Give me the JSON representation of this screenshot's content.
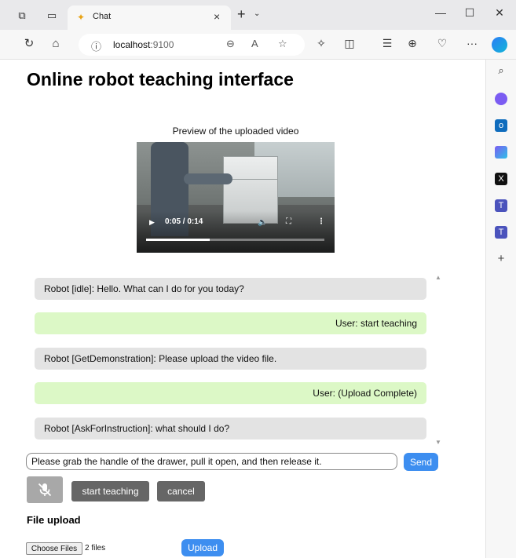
{
  "browser": {
    "tab_title": "Chat",
    "url_host": "localhost",
    "url_port": ":9100",
    "tab_close_glyph": "×",
    "new_tab_glyph": "+",
    "window_minimize_glyph": "—",
    "window_maximize_glyph": "☐",
    "window_close_glyph": "✕",
    "more_glyph": "···"
  },
  "page": {
    "title": "Online robot teaching interface"
  },
  "video": {
    "label": "Preview of the uploaded video",
    "time_display": "0:05 / 0:14",
    "progress": 0.357
  },
  "chat": {
    "messages": [
      {
        "sender": "robot",
        "text": "Robot [idle]: Hello. What can I do for you today?"
      },
      {
        "sender": "user",
        "text": "User: start teaching"
      },
      {
        "sender": "robot",
        "text": "Robot [GetDemonstration]: Please upload the video file."
      },
      {
        "sender": "user",
        "text": "User: (Upload Complete)"
      },
      {
        "sender": "robot",
        "text": "Robot [AskForInstruction]: what should I do?"
      }
    ]
  },
  "input": {
    "value": "Please grab the handle of the drawer, pull it open, and then release it.",
    "send_label": "Send"
  },
  "controls": {
    "start_teaching_label": "start teaching",
    "cancel_label": "cancel"
  },
  "file_upload": {
    "title": "File upload",
    "choose_label": "Choose Files",
    "file_count": "2 files",
    "upload_label": "Upload"
  },
  "colors": {
    "accent_blue": "#3d8ef0",
    "robot_bubble": "#e3e3e3",
    "user_bubble": "#dcf8c6",
    "dark_button": "#666666",
    "mic_button": "#a8a8a8"
  },
  "icons": {
    "titlebar": [
      "workspaces-icon",
      "tab-actions-icon",
      "favicon-icon"
    ],
    "addressbar": [
      "refresh-icon",
      "home-icon",
      "info-icon",
      "zoom-out-icon",
      "read-aloud-icon",
      "favorite-star-icon",
      "extensions-icon",
      "split-screen-icon",
      "favorites-icon",
      "collections-icon",
      "browser-essentials-icon",
      "more-icon",
      "copilot-icon"
    ],
    "sidebar": [
      "search-icon",
      "copilot-sidebar-icon",
      "outlook-icon",
      "designer-icon",
      "x-twitter-icon",
      "teams-icon",
      "teams-alt-icon",
      "add-icon"
    ]
  }
}
